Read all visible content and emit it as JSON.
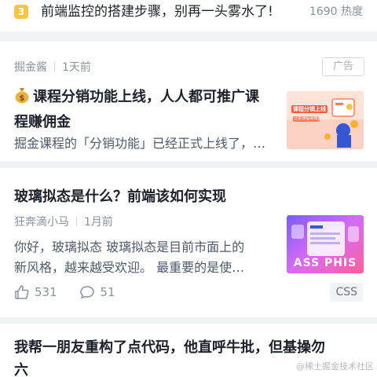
{
  "hot_item": {
    "rank": "3",
    "title": "前端监控的搭建步骤，别再一头雾水了!",
    "heat": "1690 热度"
  },
  "ad_card": {
    "author": "掘金酱",
    "time": "1天前",
    "ad_label": "广告",
    "title_line1": "课程分销功能上线，人人都可推广课",
    "title_line2": "程赚佣金",
    "excerpt": "掘金课程的「分销功能」已经正式上线了，…",
    "thumb_text": "课程分销上线",
    "thumb_subtext": "分享课程得佣金",
    "icon": "money-bag-icon"
  },
  "article_card": {
    "title": "玻璃拟态是什么？前端该如何实现",
    "author": "狂奔滴小马",
    "time": "1月前",
    "excerpt_line1": "你好，玻璃拟态 玻璃拟态是目前市面上的",
    "excerpt_line2": "新风格，越来越受欢迎。 最重要的是使…",
    "likes": "531",
    "comments": "51",
    "tag": "CSS",
    "thumb_text": "ASS PHIS"
  },
  "next_card": {
    "title_line1": "我帮一朋友重构了点代码，他直呼牛批，但基操勿",
    "title_line2": "六"
  },
  "watermark": "@稀土掘金技术社区",
  "colors": {
    "rank_badge": "#f7c544",
    "page_bg": "#f2f3f5",
    "meta_text": "#8a919f"
  }
}
